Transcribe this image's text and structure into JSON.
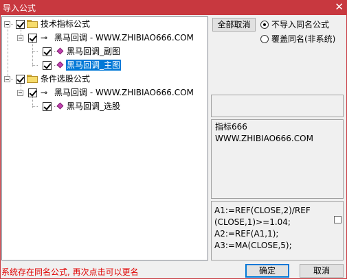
{
  "window": {
    "title": "导入公式",
    "close_glyph": "✕"
  },
  "tree": {
    "groups": [
      {
        "label": "技术指标公式",
        "formula": {
          "label": "黑马回调 - WWW.ZHIBIAO666.COM",
          "children": [
            {
              "label": "黑马回调_副图",
              "selected": false
            },
            {
              "label": "黑马回调_主图",
              "selected": true
            }
          ]
        }
      },
      {
        "label": "条件选股公式",
        "formula": {
          "label": "黑马回调 - WWW.ZHIBIAO666.COM",
          "children": [
            {
              "label": "黑马回调_选股",
              "selected": false
            }
          ]
        }
      }
    ]
  },
  "options": {
    "cancel_all_label": "全部取消",
    "radio_skip_label": "不导入同名公式",
    "radio_overwrite_label": "覆盖同名(非系统)",
    "selected_option": "不导入同名公式"
  },
  "description": {
    "line1": "指标666",
    "line2": "WWW.ZHIBIAO666.COM"
  },
  "code": {
    "line1": "A1:=REF(CLOSE,2)/REF",
    "line2": "(CLOSE,1)>=1.04;",
    "line3": "A2:=REF(A1,1);",
    "line4": "A3:=MA(CLOSE,5);"
  },
  "status_message": "系统存在同名公式, 再次点击可以更名",
  "buttons": {
    "ok_label": "确定",
    "cancel_label": "取消"
  },
  "colors": {
    "title_bar": "#c8383f",
    "selection": "#0078d7",
    "status_text": "#e00000"
  }
}
